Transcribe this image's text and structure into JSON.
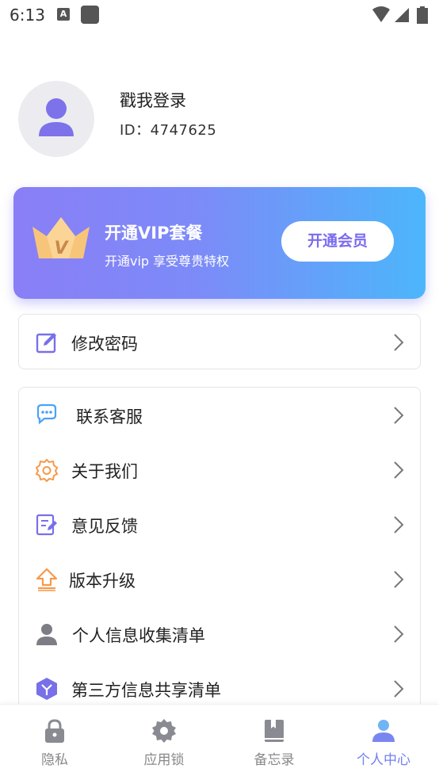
{
  "status_bar": {
    "time": "6:13",
    "notif_letter": "A"
  },
  "profile": {
    "name": "戳我登录",
    "id_text": "ID：4747625"
  },
  "vip": {
    "title": "开通VIP套餐",
    "subtitle": "开通vip 享受尊贵特权",
    "button_label": "开通会员",
    "crown_letter": "V"
  },
  "password_item": {
    "label": "修改密码"
  },
  "menu": {
    "items": [
      {
        "label": "联系客服",
        "icon": "chat-bubbles-icon"
      },
      {
        "label": "关于我们",
        "icon": "gear-icon"
      },
      {
        "label": "意见反馈",
        "icon": "edit-note-icon"
      },
      {
        "label": "版本升级",
        "icon": "upgrade-arrow-icon"
      },
      {
        "label": "个人信息收集清单",
        "icon": "person-icon"
      },
      {
        "label": "第三方信息共享清单",
        "icon": "cube-icon"
      }
    ]
  },
  "tabs": [
    {
      "label": "隐私",
      "icon": "lock-icon",
      "active": false
    },
    {
      "label": "应用锁",
      "icon": "gear-icon",
      "active": false
    },
    {
      "label": "备忘录",
      "icon": "book-icon",
      "active": false
    },
    {
      "label": "个人中心",
      "icon": "person-icon",
      "active": true
    }
  ],
  "colors": {
    "accent": "#6f7ff0",
    "vip_start": "#8a7ef6",
    "vip_end": "#4cb6fb",
    "icon_purple": "#7870e8",
    "icon_orange": "#f59a4a",
    "icon_blue": "#4aa3f5",
    "tab_gray": "#8a8a92"
  }
}
